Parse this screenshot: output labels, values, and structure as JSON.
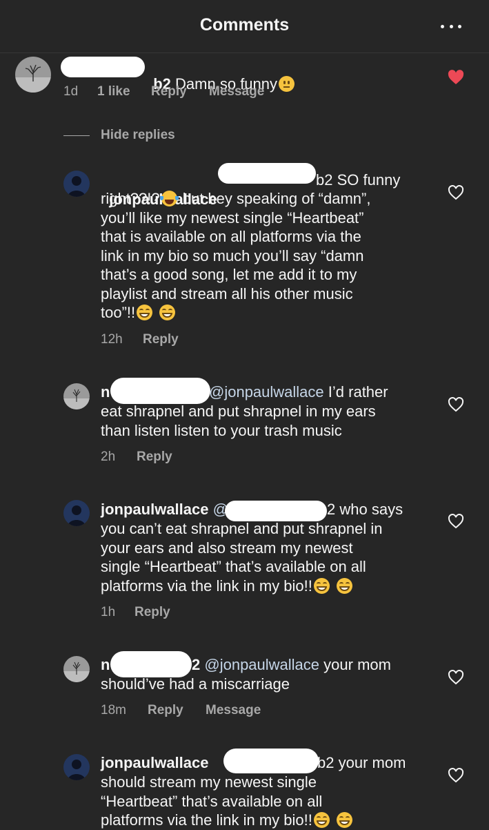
{
  "header": {
    "title": "Comments"
  },
  "top_comment": {
    "username_suffix": "b2",
    "text": "Damn so funny",
    "time": "1d",
    "likes": "1 like",
    "reply": "Reply",
    "message": "Message",
    "liked_color": "#ed4956"
  },
  "hide_replies": "Hide replies",
  "replies": [
    {
      "username": "jonpaulwallace",
      "mention_suffix": "b2",
      "line1": "SO funny",
      "line2a": "right??!?",
      "line2b": " but hey speaking of “damn”,",
      "line3": "you’ll like my newest single “Heartbeat”",
      "line4": "that is available on all platforms via the",
      "line5": "link in my bio so much you’ll say “damn",
      "line6": "that’s a good song, let me add it to my",
      "line7": "playlist and stream all his other music",
      "line8": "too”!!",
      "time": "12h",
      "reply": "Reply"
    },
    {
      "username_prefix": "n",
      "mention": "@jonpaulwallace",
      "line1": "I’d rather",
      "line2": "eat shrapnel and put shrapnel in my ears",
      "line3": "than listen listen to your trash music",
      "time": "2h",
      "reply": "Reply"
    },
    {
      "username": "jonpaulwallace",
      "mention_prefix": "@",
      "mention_suffix": "2",
      "line1": "who says",
      "line2": "you can’t eat shrapnel and put shrapnel in",
      "line3": "your ears and also stream my newest",
      "line4": "single “Heartbeat” that’s available on all",
      "line5": "platforms via the link in my bio!!",
      "time": "1h",
      "reply": "Reply"
    },
    {
      "username_prefix": "n",
      "username_suffix": "2",
      "mention": "@jonpaulwallace",
      "line1": "your mom",
      "line2": "should’ve had a miscarriage",
      "time": "18m",
      "reply": "Reply",
      "message": "Message"
    },
    {
      "username": "jonpaulwallace",
      "mention_suffix": "b2",
      "line1": "your mom",
      "line2": "should stream my newest single",
      "line3": "“Heartbeat” that’s available on all",
      "line4": "platforms via the link in my bio!!"
    }
  ]
}
